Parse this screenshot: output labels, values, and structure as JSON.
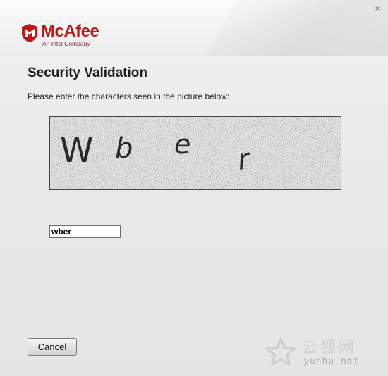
{
  "window": {
    "close_glyph": "×"
  },
  "brand": {
    "name": "McAfee",
    "tagline": "An Intel Company",
    "color": "#c01818"
  },
  "dialog": {
    "title": "Security Validation",
    "instructions": "Please enter the characters seen in the picture below:"
  },
  "captcha": {
    "characters": [
      "W",
      "b",
      "e",
      "r"
    ],
    "input_value": "wber"
  },
  "buttons": {
    "cancel_label": "Cancel"
  },
  "watermark": {
    "cn_text": "云狐网",
    "url_text": "yunhu.net"
  }
}
